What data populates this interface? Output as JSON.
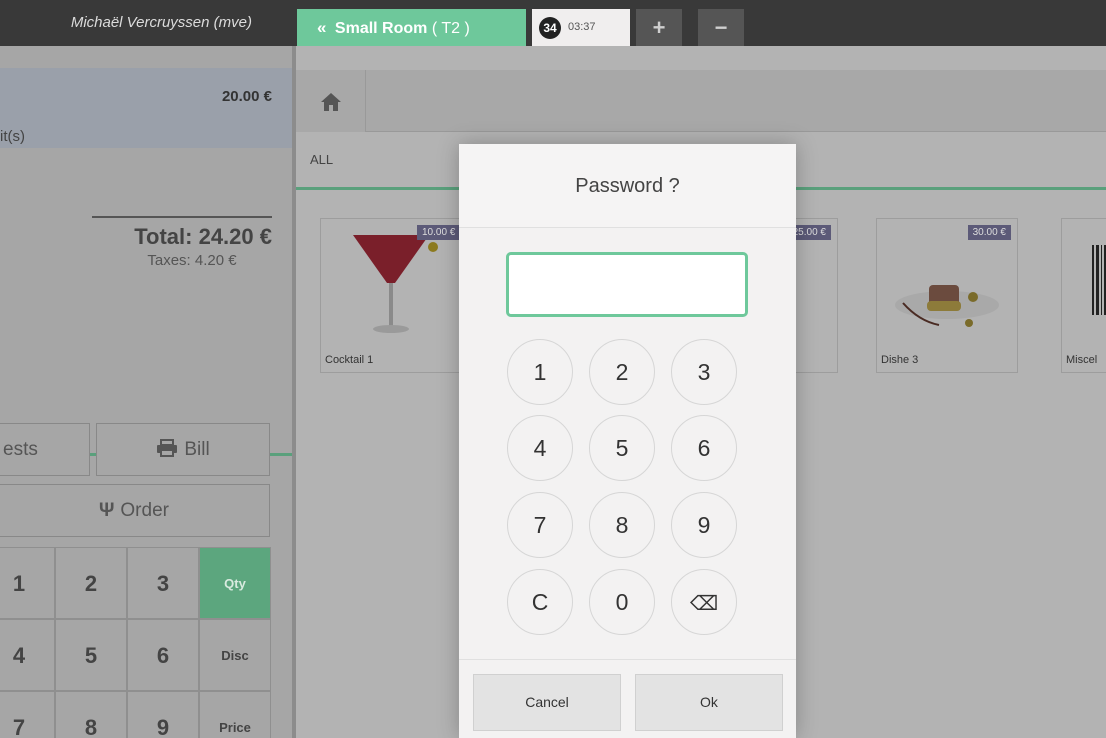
{
  "topbar": {
    "user": "Michaël Vercruyssen (mve)",
    "room_chevron": "«",
    "room_name": "Small Room",
    "room_table": "( T2 )",
    "order_count": "34",
    "order_time": "03:37",
    "add_label": "+",
    "remove_label": "−"
  },
  "order": {
    "line_price": "20.00 €",
    "line_unit": "it(s)",
    "total": "Total: 24.20 €",
    "taxes": "Taxes: 4.20 €"
  },
  "controls": {
    "guests_label": "ests",
    "bill_label": "Bill",
    "order_label": "Order"
  },
  "numpad": {
    "keys": [
      "1",
      "2",
      "3",
      "Qty",
      "4",
      "5",
      "6",
      "Disc",
      "7",
      "8",
      "9",
      "Price"
    ]
  },
  "categories": {
    "all": "ALL"
  },
  "products": [
    {
      "name": "Cocktail 1",
      "price": "10.00 €"
    },
    {
      "name": "",
      "price": "25.00 €"
    },
    {
      "name": "Dishe 3",
      "price": "30.00 €"
    },
    {
      "name": "Miscel",
      "price": ""
    }
  ],
  "password_dialog": {
    "title": "Password ?",
    "input_value": "",
    "keys": [
      "1",
      "2",
      "3",
      "4",
      "5",
      "6",
      "7",
      "8",
      "9",
      "C",
      "0",
      "⌫"
    ],
    "cancel_label": "Cancel",
    "ok_label": "Ok"
  },
  "colors": {
    "accent_green": "#6ec89b",
    "topbar": "#393939",
    "price_tag": "#5c5a78"
  }
}
